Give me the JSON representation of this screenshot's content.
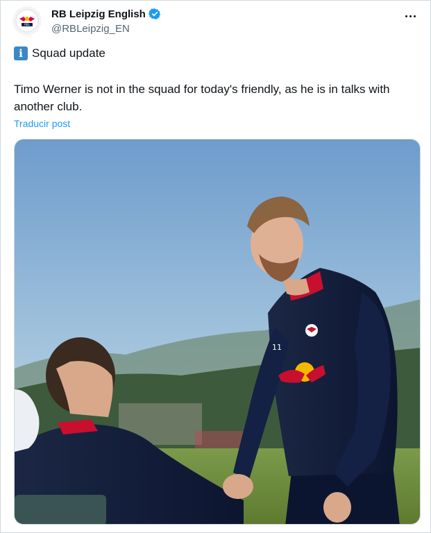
{
  "account": {
    "display_name": "RB Leipzig English",
    "handle": "@RBLeipzig_EN",
    "verified": true,
    "avatar_icon": "rb-leipzig-logo-icon"
  },
  "post": {
    "title_emoji": "info-icon",
    "title_text": "Squad update",
    "body": "Timo Werner is not in the squad for today's friendly, as he is in talks with another club.",
    "translate_link": "Traducir post"
  },
  "media": {
    "alt": "photo",
    "jersey_number": "11"
  },
  "colors": {
    "link": "#1d9bf0",
    "verified": "#1d9bf0",
    "info_icon": "#3b88c3",
    "secondary_text": "#536471",
    "border": "#cfd9de"
  }
}
